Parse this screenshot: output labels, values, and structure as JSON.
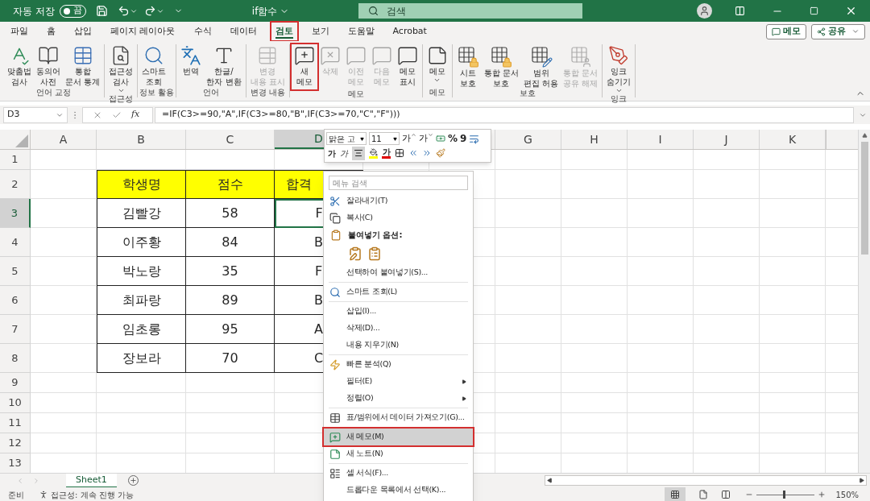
{
  "title_bar": {
    "autosave_label": "자동 저장",
    "autosave_toggle": {
      "label": "끔",
      "on": false
    },
    "file_name": "if함수",
    "search_placeholder": "검색"
  },
  "ribbon_tabs": [
    {
      "label": "파일",
      "selected": false,
      "highlighted": false
    },
    {
      "label": "홈",
      "selected": false,
      "highlighted": false
    },
    {
      "label": "삽입",
      "selected": false,
      "highlighted": false
    },
    {
      "label": "페이지 레이아웃",
      "selected": false,
      "highlighted": false
    },
    {
      "label": "수식",
      "selected": false,
      "highlighted": false
    },
    {
      "label": "데이터",
      "selected": false,
      "highlighted": false
    },
    {
      "label": "검토",
      "selected": true,
      "highlighted": true
    },
    {
      "label": "보기",
      "selected": false,
      "highlighted": false
    },
    {
      "label": "도움말",
      "selected": false,
      "highlighted": false
    },
    {
      "label": "Acrobat",
      "selected": false,
      "highlighted": false
    }
  ],
  "top_buttons": [
    {
      "label": "메모",
      "dropdown": false
    },
    {
      "label": "공유",
      "dropdown": true
    }
  ],
  "ribbon_groups": [
    {
      "label": "언어 교정",
      "buttons": [
        {
          "lines": [
            "맞춤법",
            "검사"
          ],
          "disabled": false,
          "dropdown": false,
          "highlighted": false
        },
        {
          "lines": [
            "동의어",
            "사전"
          ],
          "disabled": false,
          "dropdown": false,
          "highlighted": false
        },
        {
          "lines": [
            "통합",
            "문서 통계"
          ],
          "disabled": false,
          "dropdown": false,
          "highlighted": false
        }
      ]
    },
    {
      "label": "접근성",
      "buttons": [
        {
          "lines": [
            "접근성",
            "검사"
          ],
          "disabled": false,
          "dropdown": true,
          "highlighted": false
        }
      ]
    },
    {
      "label": "정보 활용",
      "buttons": [
        {
          "lines": [
            "스마트",
            "조회"
          ],
          "disabled": false,
          "dropdown": false,
          "highlighted": false
        }
      ]
    },
    {
      "label": "언어",
      "buttons": [
        {
          "lines": [
            "번역"
          ],
          "disabled": false,
          "dropdown": false,
          "highlighted": false
        },
        {
          "lines": [
            "한글/",
            "한자 변환"
          ],
          "disabled": false,
          "dropdown": false,
          "highlighted": false
        }
      ]
    },
    {
      "label": "변경 내용",
      "buttons": [
        {
          "lines": [
            "변경",
            "내용 표시"
          ],
          "disabled": true,
          "dropdown": false,
          "highlighted": false
        }
      ]
    },
    {
      "label": "메모",
      "buttons": [
        {
          "lines": [
            "새",
            "메모"
          ],
          "disabled": false,
          "dropdown": false,
          "highlighted": true
        },
        {
          "lines": [
            "삭제"
          ],
          "disabled": true,
          "dropdown": false,
          "highlighted": false
        },
        {
          "lines": [
            "이전",
            "메모"
          ],
          "disabled": true,
          "dropdown": false,
          "highlighted": false
        },
        {
          "lines": [
            "다음",
            "메모"
          ],
          "disabled": true,
          "dropdown": false,
          "highlighted": false
        },
        {
          "lines": [
            "메모",
            "표시"
          ],
          "disabled": false,
          "dropdown": false,
          "highlighted": false
        }
      ]
    },
    {
      "label": "메모",
      "buttons": [
        {
          "lines": [
            "메모"
          ],
          "disabled": false,
          "dropdown": true,
          "highlighted": false
        }
      ]
    },
    {
      "label": "보호",
      "buttons": [
        {
          "lines": [
            "시트",
            "보호"
          ],
          "disabled": false,
          "dropdown": false,
          "highlighted": false
        },
        {
          "lines": [
            "통합 문서",
            "보호"
          ],
          "disabled": false,
          "dropdown": false,
          "highlighted": false
        },
        {
          "lines": [
            "범위",
            "편집 허용"
          ],
          "disabled": false,
          "dropdown": false,
          "highlighted": false
        },
        {
          "lines": [
            "통합 문서",
            "공유 해제"
          ],
          "disabled": true,
          "dropdown": false,
          "highlighted": false
        }
      ]
    },
    {
      "label": "잉크",
      "buttons": [
        {
          "lines": [
            "잉크",
            "숨기기"
          ],
          "disabled": false,
          "dropdown": true,
          "highlighted": false
        }
      ]
    }
  ],
  "formula_bar": {
    "name_box": "D3",
    "function_label": "fx",
    "formula": "=IF(C3>=90,\"A\",IF(C3>=80,\"B\",IF(C3>=70,\"C\",\"F\")))"
  },
  "sheet": {
    "columns": [
      {
        "label": "A",
        "selected": false
      },
      {
        "label": "B",
        "selected": false
      },
      {
        "label": "C",
        "selected": false
      },
      {
        "label": "D",
        "selected": true
      },
      {},
      {},
      {
        "label": "G",
        "selected": false
      },
      {
        "label": "H",
        "selected": false
      },
      {
        "label": "I",
        "selected": false
      },
      {
        "label": "J",
        "selected": false
      },
      {
        "label": "K",
        "selected": false
      }
    ],
    "rows": [
      {
        "label": "1",
        "selected": false,
        "cells": []
      },
      {
        "label": "2",
        "selected": false,
        "cells": [
          {
            "text": "",
            "kind": "empty",
            "selected": false
          },
          {
            "text": "학생명",
            "kind": "header",
            "selected": false
          },
          {
            "text": "점수",
            "kind": "header",
            "selected": false
          },
          {
            "text": "합격",
            "kind": "header",
            "selected": false
          }
        ]
      },
      {
        "label": "3",
        "selected": true,
        "cells": [
          {
            "text": "",
            "kind": "empty",
            "selected": false
          },
          {
            "text": "김빨강",
            "kind": "data",
            "selected": false
          },
          {
            "text": "58",
            "kind": "data",
            "selected": false
          },
          {
            "text": "F",
            "kind": "data",
            "selected": true
          }
        ]
      },
      {
        "label": "4",
        "selected": false,
        "cells": [
          {
            "text": "",
            "kind": "empty",
            "selected": false
          },
          {
            "text": "이주황",
            "kind": "data",
            "selected": false
          },
          {
            "text": "84",
            "kind": "data",
            "selected": false
          },
          {
            "text": "B",
            "kind": "data",
            "selected": false
          }
        ]
      },
      {
        "label": "5",
        "selected": false,
        "cells": [
          {
            "text": "",
            "kind": "empty",
            "selected": false
          },
          {
            "text": "박노랑",
            "kind": "data",
            "selected": false
          },
          {
            "text": "35",
            "kind": "data",
            "selected": false
          },
          {
            "text": "F",
            "kind": "data",
            "selected": false
          }
        ]
      },
      {
        "label": "6",
        "selected": false,
        "cells": [
          {
            "text": "",
            "kind": "empty",
            "selected": false
          },
          {
            "text": "최파랑",
            "kind": "data",
            "selected": false
          },
          {
            "text": "89",
            "kind": "data",
            "selected": false
          },
          {
            "text": "B",
            "kind": "data",
            "selected": false
          }
        ]
      },
      {
        "label": "7",
        "selected": false,
        "cells": [
          {
            "text": "",
            "kind": "empty",
            "selected": false
          },
          {
            "text": "임초롱",
            "kind": "data",
            "selected": false
          },
          {
            "text": "95",
            "kind": "data",
            "selected": false
          },
          {
            "text": "A",
            "kind": "data",
            "selected": false
          }
        ]
      },
      {
        "label": "8",
        "selected": false,
        "cells": [
          {
            "text": "",
            "kind": "empty",
            "selected": false
          },
          {
            "text": "장보라",
            "kind": "data",
            "selected": false
          },
          {
            "text": "70",
            "kind": "data",
            "selected": false
          },
          {
            "text": "C",
            "kind": "data",
            "selected": false
          }
        ]
      },
      {
        "label": "9",
        "selected": false,
        "cells": []
      },
      {
        "label": "10",
        "selected": false,
        "cells": []
      },
      {
        "label": "11",
        "selected": false,
        "cells": []
      },
      {
        "label": "12",
        "selected": false,
        "cells": []
      },
      {
        "label": "13",
        "selected": false,
        "cells": []
      }
    ]
  },
  "mini_toolbar": {
    "font_name": "맑은 고",
    "font_size": "11",
    "grow_font": "가",
    "shrink_font": "가",
    "percent": "%",
    "comma": "9",
    "bold": "가",
    "italic": "가",
    "font_color": "가",
    "align_center": {
      "selected": true
    }
  },
  "context_menu": {
    "search_placeholder": "메뉴 검색",
    "items": [
      {
        "kind": "item",
        "label": "잘라내기(T)",
        "submenu": false,
        "highlighted": false
      },
      {
        "kind": "item",
        "label": "복사(C)",
        "submenu": false,
        "highlighted": false
      },
      {
        "kind": "header",
        "label": "붙여넣기 옵션:"
      },
      {
        "kind": "paste_options"
      },
      {
        "kind": "item",
        "label": "선택하여 붙여넣기(S)...",
        "submenu": false,
        "highlighted": false
      },
      {
        "kind": "separator"
      },
      {
        "kind": "item",
        "label": "스마트 조회(L)",
        "submenu": false,
        "highlighted": false
      },
      {
        "kind": "separator"
      },
      {
        "kind": "item",
        "label": "삽입(I)...",
        "submenu": false,
        "highlighted": false
      },
      {
        "kind": "item",
        "label": "삭제(D)...",
        "submenu": false,
        "highlighted": false
      },
      {
        "kind": "item",
        "label": "내용 지우기(N)",
        "submenu": false,
        "highlighted": false
      },
      {
        "kind": "separator"
      },
      {
        "kind": "item",
        "label": "빠른 분석(Q)",
        "submenu": false,
        "highlighted": false
      },
      {
        "kind": "item",
        "label": "필터(E)",
        "submenu": true,
        "highlighted": false
      },
      {
        "kind": "item",
        "label": "정렬(O)",
        "submenu": true,
        "highlighted": false
      },
      {
        "kind": "separator"
      },
      {
        "kind": "item",
        "label": "표/범위에서 데이터 가져오기(G)...",
        "submenu": false,
        "highlighted": false
      },
      {
        "kind": "separator"
      },
      {
        "kind": "item",
        "label": "새 메모(M)",
        "submenu": false,
        "highlighted": true
      },
      {
        "kind": "item",
        "label": "새 노트(N)",
        "submenu": false,
        "highlighted": false
      },
      {
        "kind": "separator"
      },
      {
        "kind": "item",
        "label": "셀 서식(F)...",
        "submenu": false,
        "highlighted": false
      },
      {
        "kind": "item",
        "label": "드롭다운 목록에서 선택(K)...",
        "submenu": false,
        "highlighted": false
      }
    ]
  },
  "sheet_tabs": [
    {
      "label": "Sheet1",
      "selected": true
    }
  ],
  "status_bar": {
    "ready": "준비",
    "accessibility": "접근성: 계속 진행 가능",
    "zoom": {
      "level": 0.45,
      "reading": "150%"
    }
  }
}
